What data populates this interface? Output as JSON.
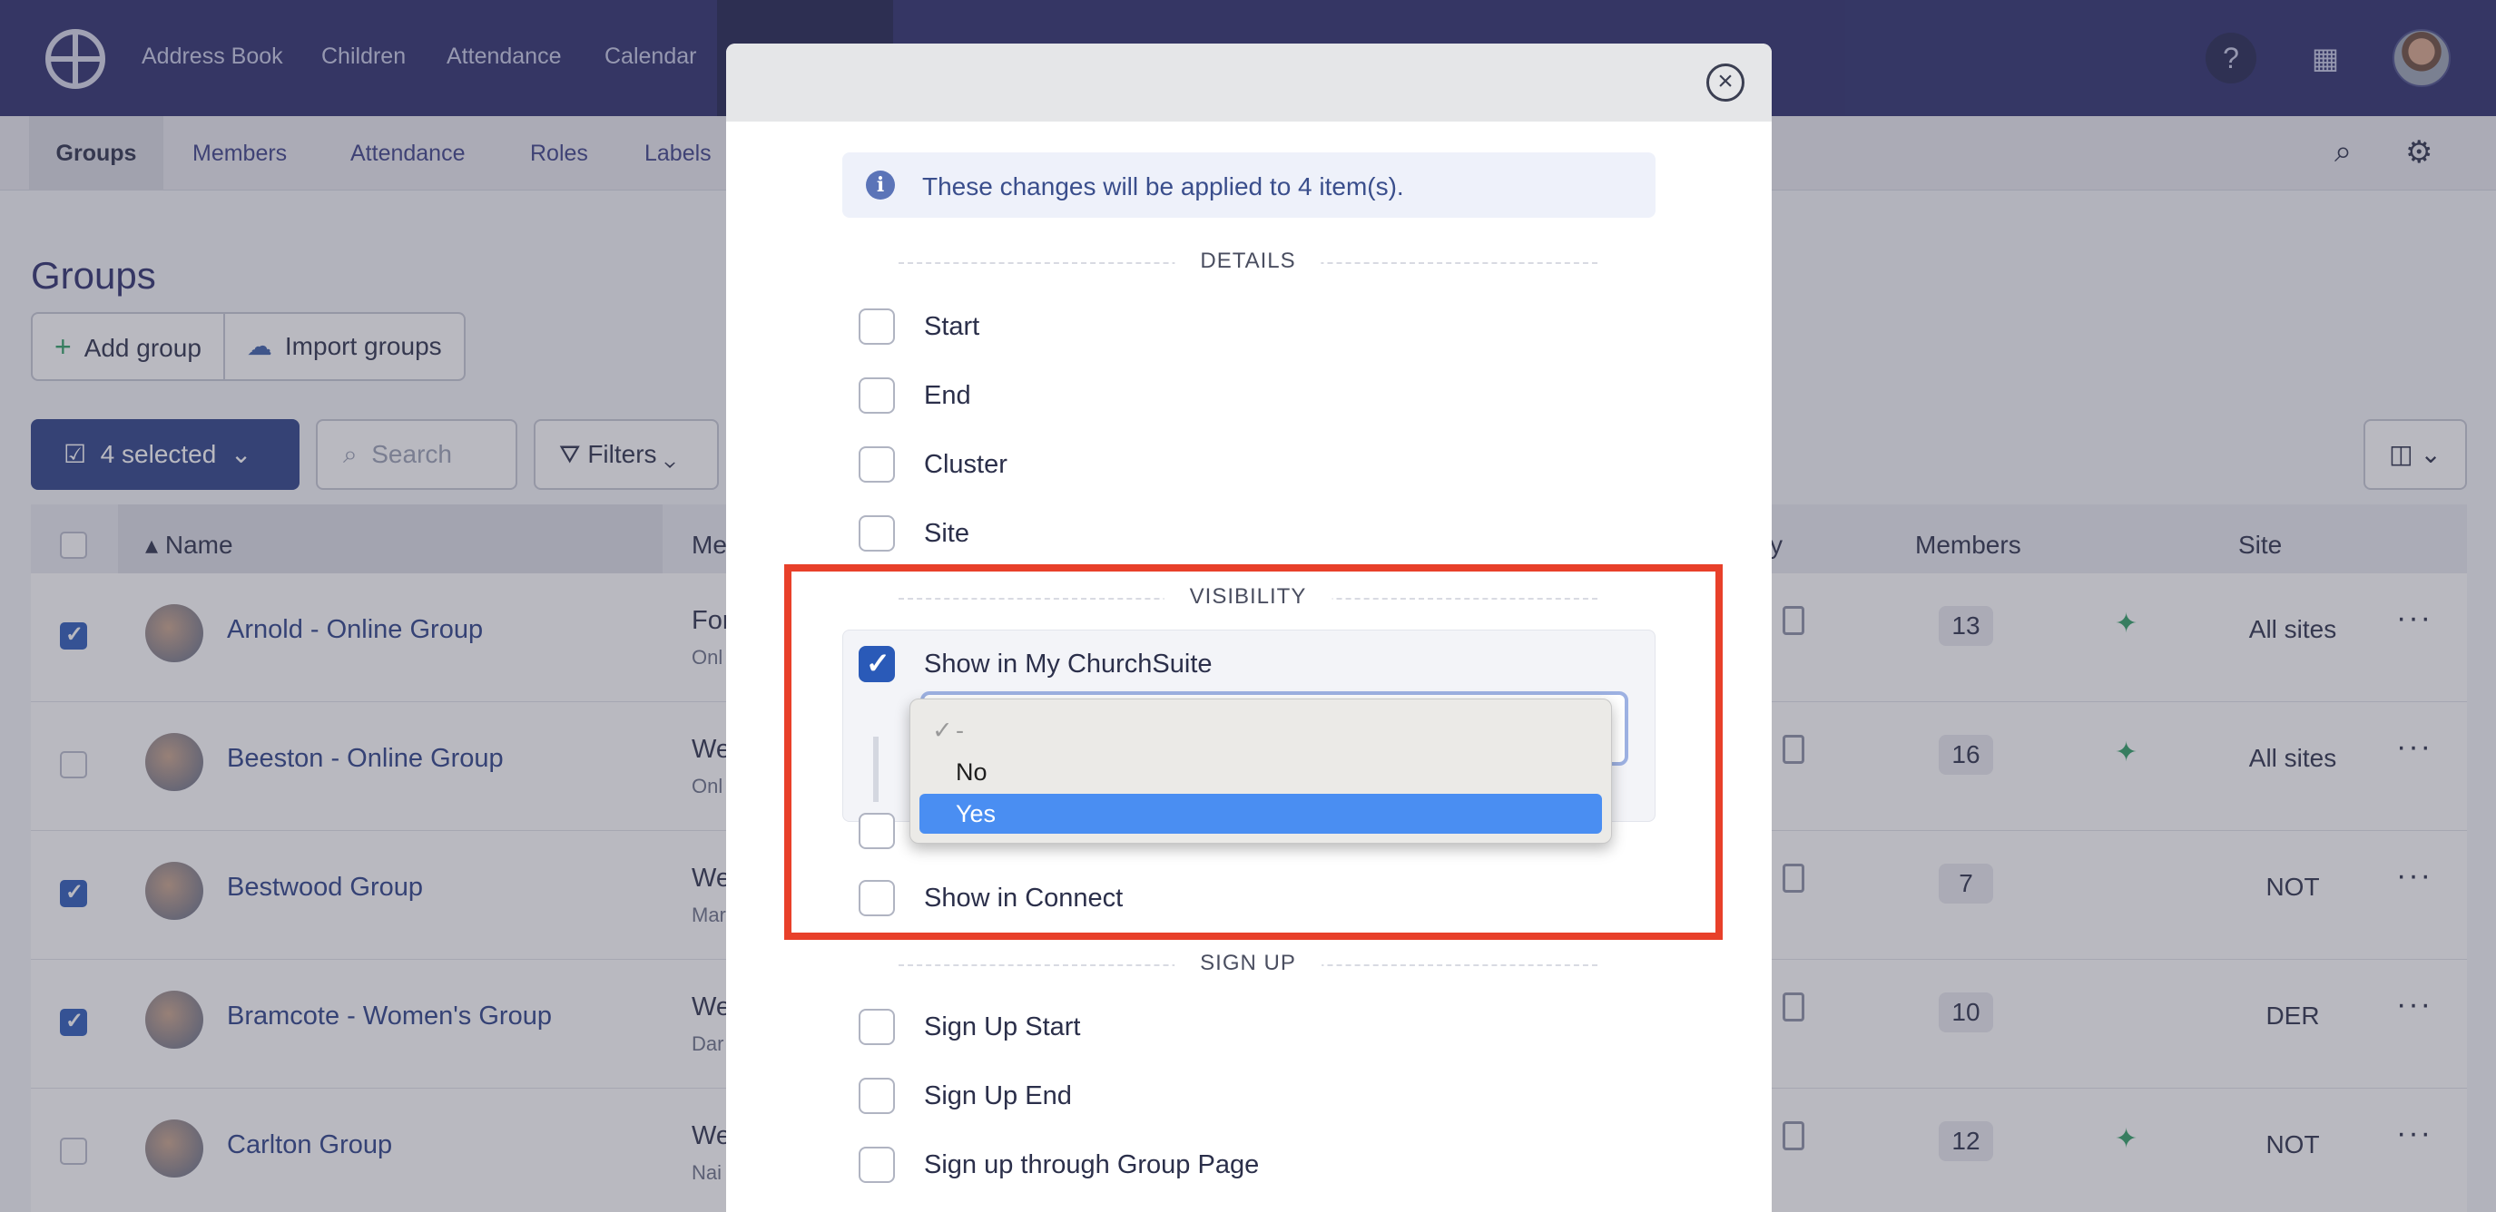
{
  "topnav": {
    "links": [
      "Address Book",
      "Children",
      "Attendance",
      "Calendar"
    ]
  },
  "subnav": {
    "tabs": [
      "Groups",
      "Members",
      "Attendance",
      "Roles",
      "Labels"
    ]
  },
  "page": {
    "title": "Groups",
    "add_group": "Add group",
    "import_groups": "Import groups",
    "selected": "4 selected",
    "search_placeholder": "Search",
    "filters": "Filters"
  },
  "table": {
    "columns": {
      "name": "Name",
      "meeting": "Me",
      "visibility": "y",
      "members": "Members",
      "site": "Site"
    },
    "rows": [
      {
        "name": "Arnold - Online Group",
        "desc": "For",
        "sub": "Onl",
        "count": "13",
        "site": "All sites",
        "checked": true
      },
      {
        "name": "Beeston - Online Group",
        "desc": "We",
        "sub": "Onl",
        "count": "16",
        "site": "All sites",
        "checked": false
      },
      {
        "name": "Bestwood Group",
        "desc": "We",
        "sub": "Mar",
        "count": "7",
        "site": "NOT",
        "checked": true
      },
      {
        "name": "Bramcote - Women's Group",
        "desc": "We",
        "sub": "Dar",
        "count": "10",
        "site": "DER",
        "checked": true
      },
      {
        "name": "Carlton Group",
        "desc": "We",
        "sub": "Nai",
        "count": "12",
        "site": "NOT",
        "checked": false
      }
    ]
  },
  "modal": {
    "info": "These changes will be applied to 4 item(s).",
    "sections": {
      "details": "DETAILS",
      "visibility": "VISIBILITY",
      "signup": "SIGN UP"
    },
    "details_fields": [
      "Start",
      "End",
      "Cluster",
      "Site"
    ],
    "visibility_fields": {
      "show_in_churchsuite": "Show in My ChurchSuite",
      "show_in_connect": "Show in Connect"
    },
    "signup_fields": [
      "Sign Up Start",
      "Sign Up End",
      "Sign up through Group Page"
    ]
  },
  "dropdown": {
    "placeholder": "-",
    "options": [
      "No",
      "Yes"
    ],
    "selected": "Yes"
  },
  "colors": {
    "nav": "#2a2d6b",
    "accent": "#2a5ab8",
    "highlight": "#e8402a",
    "dropdown_selected": "#4a8ef2"
  }
}
